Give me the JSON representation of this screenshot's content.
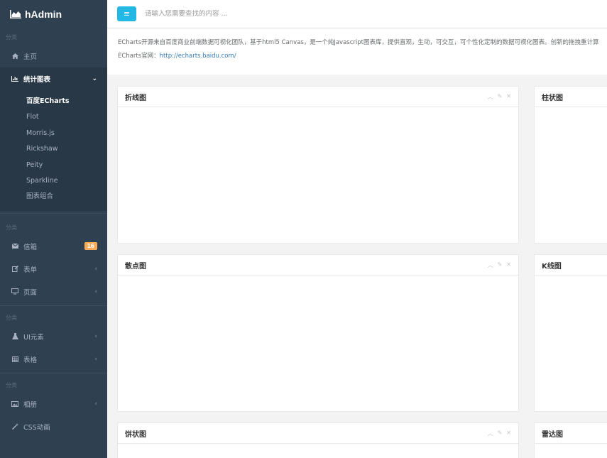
{
  "brand": {
    "title": "hAdmin"
  },
  "sidebar": {
    "section1": "分类",
    "home": "主页",
    "charts": {
      "label": "统计图表",
      "items": [
        "百度ECharts",
        "Flot",
        "Morris.js",
        "Rickshaw",
        "Peity",
        "Sparkline",
        "图表组合"
      ]
    },
    "section2": "分类",
    "mailbox": {
      "label": "信箱",
      "badge": "16"
    },
    "forms": "表单",
    "pages": "页面",
    "section3": "分类",
    "ui": "UI元素",
    "tables": "表格",
    "section4": "分类",
    "gallery": "相册",
    "css_anim": "CSS动画"
  },
  "topbar": {
    "search_placeholder": "请输入您需要查找的内容 …"
  },
  "intro": {
    "line1": "ECharts开源来自百度商业前端数据可视化团队，基于html5 Canvas，是一个纯Javascript图表库，提供直观，生动，可交互，可个性化定制的数据可视化图表。创新的拖拽重计算",
    "line2_prefix": "ECharts官网：",
    "link": "http://echarts.baidu.com/"
  },
  "panels": {
    "line": "折线图",
    "bar": "柱状图",
    "scatter": "散点图",
    "kline": "K线图",
    "pie": "饼状图",
    "radar": "雷达图"
  },
  "colors": {
    "sidebar_bg": "#2f4050",
    "accent": "#23b7e5",
    "badge": "#f8ac59"
  }
}
